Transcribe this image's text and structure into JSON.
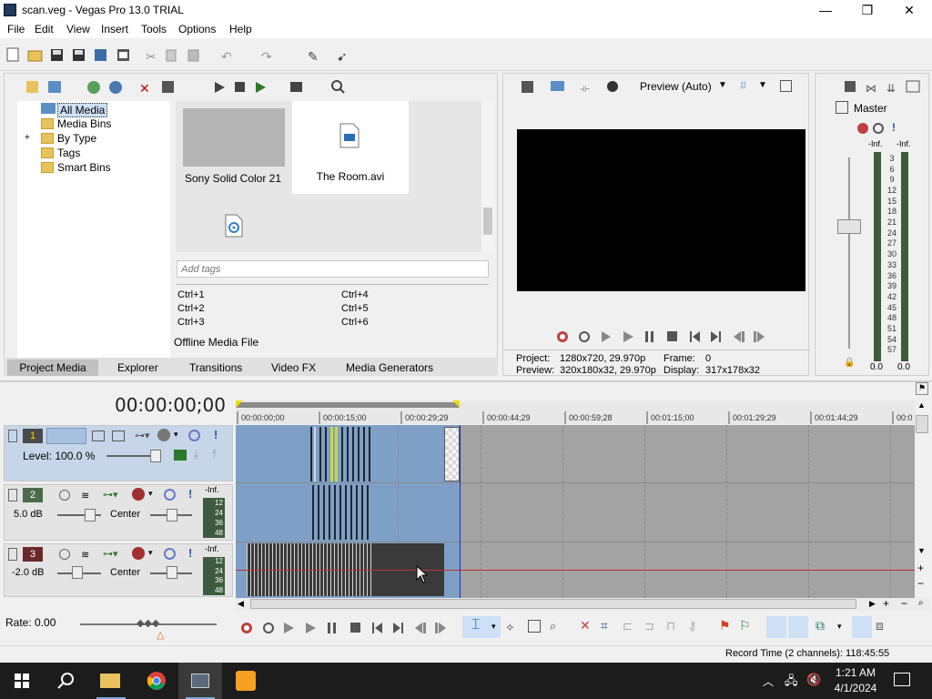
{
  "window": {
    "title": "scan.veg - Vegas Pro 13.0 TRIAL",
    "min": "—",
    "max": "❐",
    "close": "✕"
  },
  "menu": [
    "File",
    "Edit",
    "View",
    "Insert",
    "Tools",
    "Options",
    "Help"
  ],
  "explorer": {
    "tree": [
      "All Media",
      "Media Bins",
      "By Type",
      "Tags",
      "Smart Bins"
    ],
    "expand_glyph": "+",
    "media": [
      {
        "name": "Sony Solid Color 21"
      },
      {
        "name": "The Room.avi"
      }
    ],
    "tags_placeholder": "Add tags",
    "shortcuts": [
      "Ctrl+1",
      "Ctrl+2",
      "Ctrl+3",
      "Ctrl+4",
      "Ctrl+5",
      "Ctrl+6"
    ],
    "status": "Offline Media File",
    "tabs": [
      "Project Media",
      "Explorer",
      "Transitions",
      "Video FX",
      "Media Generators"
    ]
  },
  "preview": {
    "mode": "Preview (Auto)",
    "project_label": "Project:",
    "project_value": "1280x720, 29.970p",
    "preview_label": "Preview:",
    "preview_value": "320x180x32, 29.970p",
    "frame_label": "Frame:",
    "frame_value": "0",
    "display_label": "Display:",
    "display_value": "317x178x32"
  },
  "mixer": {
    "title": "Master",
    "left_peak": "-Inf.",
    "right_peak": "-Inf.",
    "scale": [
      "3",
      "6",
      "9",
      "12",
      "15",
      "18",
      "21",
      "24",
      "27",
      "30",
      "33",
      "36",
      "39",
      "42",
      "45",
      "48",
      "51",
      "54",
      "57"
    ],
    "left_val": "0.0",
    "right_val": "0.0"
  },
  "timeline": {
    "timecode": "00:00:00;00",
    "ruler": [
      "00:00:00;00",
      "00:00:15;00",
      "00:00:29;29",
      "00:00:44;29",
      "00:00:59;28",
      "00:01:15;00",
      "00:01:29;29",
      "00:01:44;29",
      "00:0"
    ],
    "tracks": [
      {
        "num": "1",
        "kind": "video",
        "level": "Level: 100.0 %"
      },
      {
        "num": "2",
        "kind": "audio",
        "vol": "5.0 dB",
        "pan": "Center",
        "peak": "-Inf.",
        "scale": [
          "12",
          "24",
          "36",
          "48"
        ]
      },
      {
        "num": "3",
        "kind": "audio",
        "vol": "-2.0 dB",
        "pan": "Center",
        "peak": "-Inf.",
        "scale": [
          "12",
          "24",
          "36",
          "48"
        ]
      }
    ],
    "rate": "Rate: 0.00",
    "record_time": "Record Time (2 channels): 118:45:55"
  },
  "taskbar": {
    "time": "1:21 AM",
    "date": "4/1/2024"
  },
  "colors": {
    "accent": "#1f4e9c",
    "selection_blue": "#7fa0c6",
    "video_track": "#1d1d1d"
  }
}
